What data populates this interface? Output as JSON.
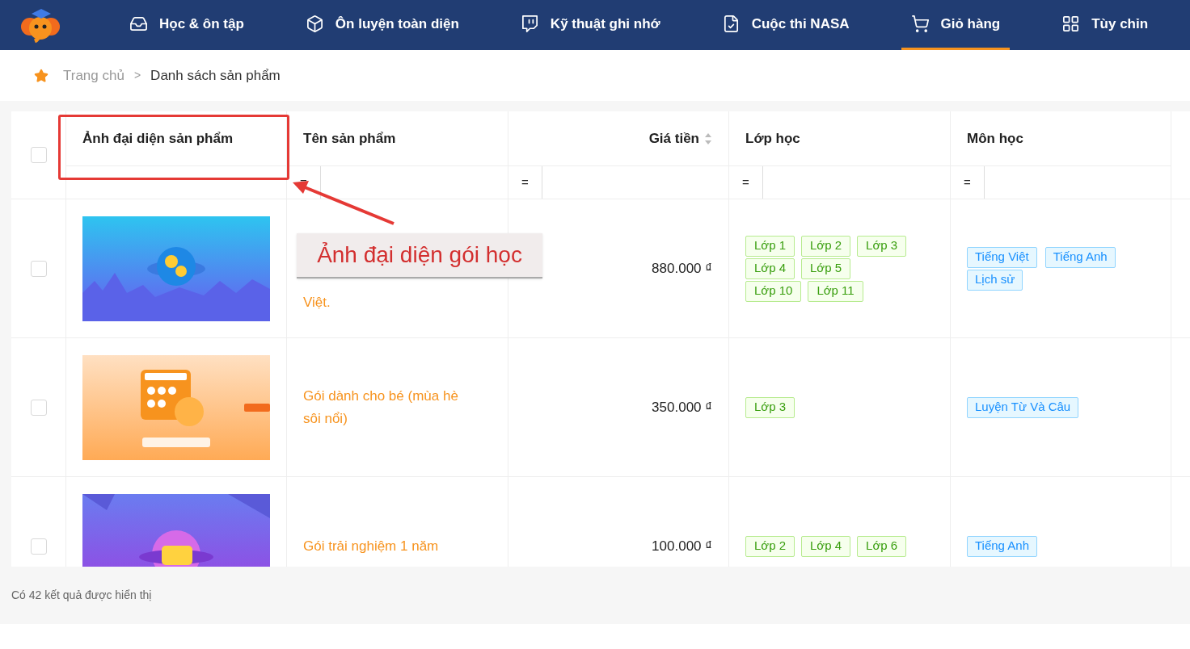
{
  "nav": {
    "items": [
      {
        "label": "Học & ôn tập",
        "selected": false
      },
      {
        "label": "Ôn luyện toàn diện",
        "selected": false
      },
      {
        "label": "Kỹ thuật ghi nhớ",
        "selected": false
      },
      {
        "label": "Cuộc thi NASA",
        "selected": false
      },
      {
        "label": "Giỏ hàng",
        "selected": true
      },
      {
        "label": "Tùy chỉn",
        "selected": false
      }
    ]
  },
  "breadcrumb": {
    "items": [
      "Trang chủ",
      "Danh sách sản phẩm"
    ],
    "separator": ">"
  },
  "table": {
    "select_all": {
      "checked": false
    },
    "columns": [
      {
        "label": "Ảnh đại diện sản phẩm"
      },
      {
        "label": "Tên sản phẩm",
        "filter": "="
      },
      {
        "label": "Giá tiền",
        "sortable": true,
        "filter": "="
      },
      {
        "label": "Lớp học",
        "filter": "="
      },
      {
        "label": "Môn học",
        "filter": "="
      }
    ],
    "rows": [
      {
        "checked": false,
        "name": [
          "Việt."
        ],
        "price": "880.000 ₫",
        "classes": [
          "Lớp 1",
          "Lớp 2",
          "Lớp 3",
          "Lớp 4",
          "Lớp 5",
          "Lớp 10",
          "Lớp 11"
        ],
        "subjects": [
          "Tiếng Việt",
          "Tiếng Anh",
          "Lịch sử"
        ]
      },
      {
        "checked": false,
        "name": [
          "Gói dành cho bé (mùa hè",
          "sôi nổi)"
        ],
        "price": "350.000 ₫",
        "classes": [
          "Lớp 3"
        ],
        "subjects": [
          "Luyện Từ Và Câu"
        ]
      },
      {
        "checked": false,
        "name": [
          "Gói trải nghiệm 1 năm"
        ],
        "price": "100.000 ₫",
        "classes": [
          "Lớp 2",
          "Lớp 4",
          "Lớp 6"
        ],
        "subjects": [
          "Tiếng Anh"
        ]
      }
    ]
  },
  "annotation": {
    "label": "Ảnh đại diện gói học"
  },
  "footer": {
    "text": "Có 42 kết quả được hiển thị"
  }
}
